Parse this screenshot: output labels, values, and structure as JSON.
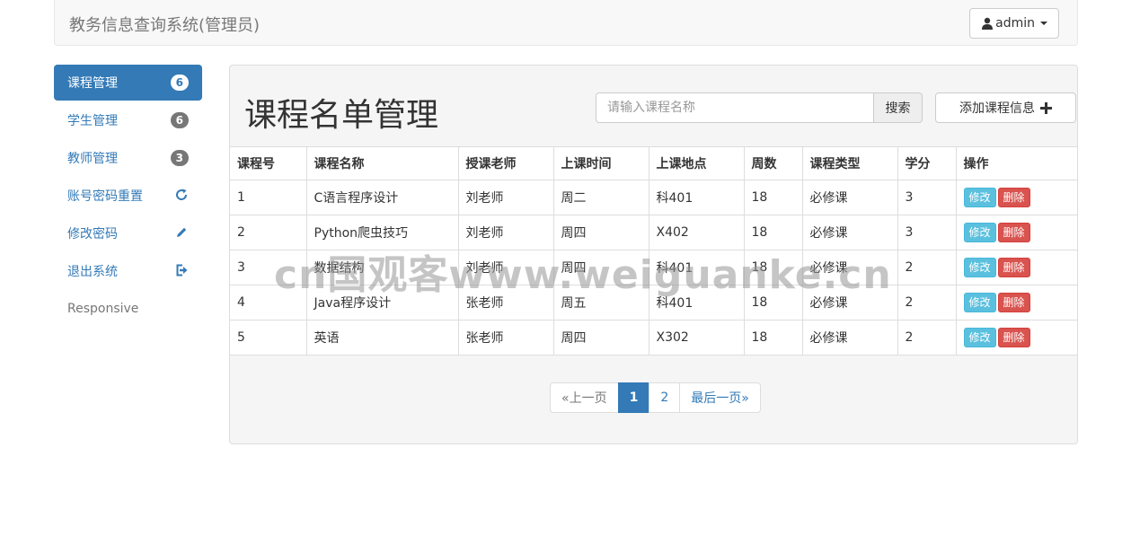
{
  "navbar": {
    "brand": "教务信息查询系统(管理员)",
    "user_label": "admin"
  },
  "sidebar": {
    "items": [
      {
        "label": "课程管理",
        "badge": "6"
      },
      {
        "label": "学生管理",
        "badge": "6"
      },
      {
        "label": "教师管理",
        "badge": "3"
      },
      {
        "label": "账号密码重置",
        "icon": "refresh-icon"
      },
      {
        "label": "修改密码",
        "icon": "pencil-icon"
      },
      {
        "label": "退出系统",
        "icon": "logout-icon"
      },
      {
        "label": "Responsive"
      }
    ]
  },
  "main": {
    "title": "课程名单管理",
    "search": {
      "placeholder": "请输入课程名称",
      "button_label": "搜索"
    },
    "add_button_label": "添加课程信息"
  },
  "table": {
    "headers": [
      "课程号",
      "课程名称",
      "授课老师",
      "上课时间",
      "上课地点",
      "周数",
      "课程类型",
      "学分",
      "操作"
    ],
    "rows": [
      [
        "1",
        "C语言程序设计",
        "刘老师",
        "周二",
        "科401",
        "18",
        "必修课",
        "3"
      ],
      [
        "2",
        "Python爬虫技巧",
        "刘老师",
        "周四",
        "X402",
        "18",
        "必修课",
        "3"
      ],
      [
        "3",
        "数据结构",
        "刘老师",
        "周四",
        "科401",
        "18",
        "必修课",
        "2"
      ],
      [
        "4",
        "Java程序设计",
        "张老师",
        "周五",
        "科401",
        "18",
        "必修课",
        "2"
      ],
      [
        "5",
        "英语",
        "张老师",
        "周四",
        "X302",
        "18",
        "必修课",
        "2"
      ]
    ],
    "edit_label": "修改",
    "delete_label": "删除"
  },
  "pagination": {
    "prev_label": "«上一页",
    "pages": [
      "1",
      "2"
    ],
    "last_label": "最后一页»"
  },
  "watermark": "cn国观客www.weiguanke.cn",
  "colors": {
    "primary": "#337ab7",
    "info": "#5bc0de",
    "danger": "#d9534f"
  }
}
